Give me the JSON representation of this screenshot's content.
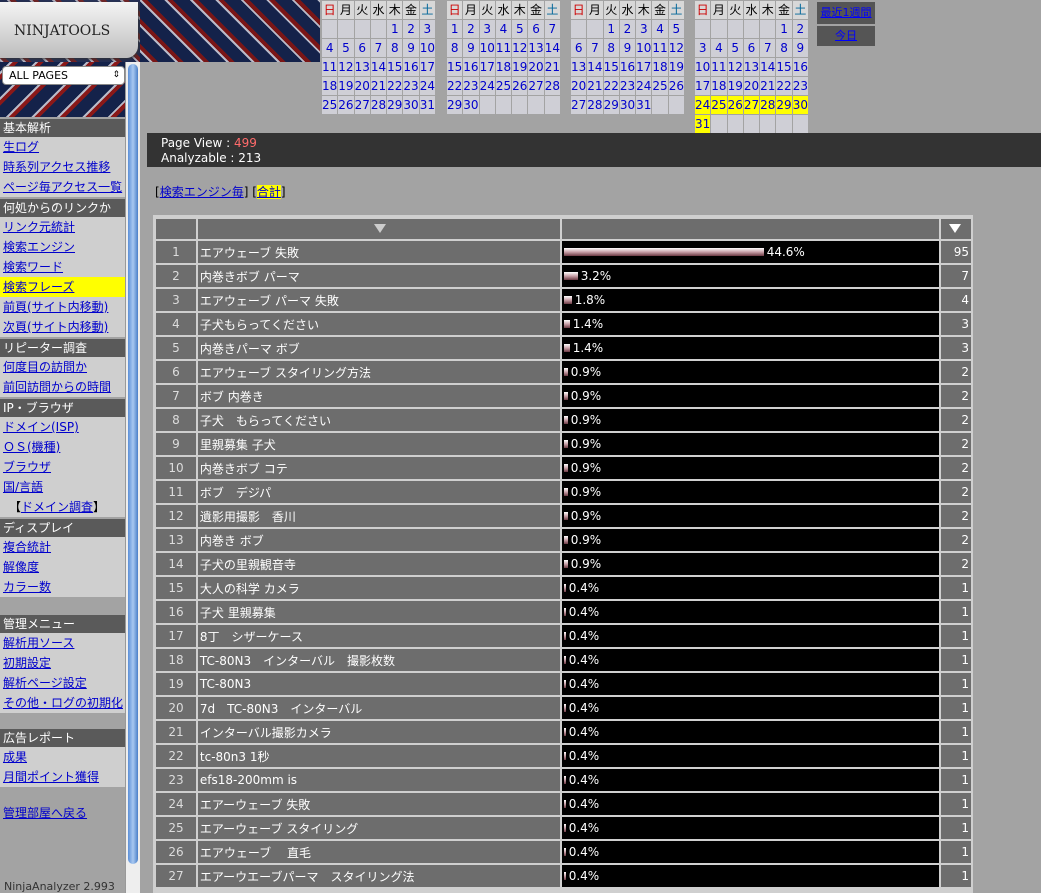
{
  "logo": {
    "text": "NINJATOOLS"
  },
  "page_select": {
    "value": "ALL PAGES"
  },
  "sidebar": [
    {
      "title": "基本解析",
      "items": [
        {
          "label": "生ログ"
        },
        {
          "label": "時系列アクセス推移"
        },
        {
          "label": "ページ毎アクセス一覧"
        }
      ]
    },
    {
      "title": "何処からのリンクか",
      "items": [
        {
          "label": "リンク元統計"
        },
        {
          "label": "検索エンジン"
        },
        {
          "label": "検索ワード"
        },
        {
          "label": "検索フレーズ",
          "active": true
        },
        {
          "label": "前頁(サイト内移動)"
        },
        {
          "label": "次頁(サイト内移動)"
        }
      ]
    },
    {
      "title": "リピーター調査",
      "items": [
        {
          "label": "何度目の訪問か"
        },
        {
          "label": "前回訪問からの時間"
        }
      ]
    },
    {
      "title": "IP・ブラウザ",
      "items": [
        {
          "label": "ドメイン(ISP)"
        },
        {
          "label": "ＯＳ(機種)"
        },
        {
          "label": "ブラウザ"
        },
        {
          "label": "国/言語"
        }
      ],
      "extra": "ドメイン調査"
    },
    {
      "title": "ディスプレイ",
      "items": [
        {
          "label": "複合統計"
        },
        {
          "label": "解像度"
        },
        {
          "label": "カラー数"
        }
      ]
    },
    {
      "title": "管理メニュー",
      "items": [
        {
          "label": "解析用ソース"
        },
        {
          "label": "初期設定"
        },
        {
          "label": "解析ページ設定"
        },
        {
          "label": "その他・ログの初期化"
        }
      ]
    },
    {
      "title": "広告レポート",
      "items": [
        {
          "label": "成果"
        },
        {
          "label": "月間ポイント獲得"
        }
      ]
    }
  ],
  "sidebar_back": "管理部屋へ戻る",
  "footer_version": "NinjaAnalyzer 2.993",
  "calendar": {
    "weekdays": [
      "日",
      "月",
      "火",
      "水",
      "木",
      "金",
      "土"
    ],
    "months": [
      {
        "weeks": [
          [
            "",
            "",
            "",
            "",
            "1",
            "2",
            "3"
          ],
          [
            "4",
            "5",
            "6",
            "7",
            "8",
            "9",
            "10"
          ],
          [
            "11",
            "12",
            "13",
            "14",
            "15",
            "16",
            "17"
          ],
          [
            "18",
            "19",
            "20",
            "21",
            "22",
            "23",
            "24"
          ],
          [
            "25",
            "26",
            "27",
            "28",
            "29",
            "30",
            "31"
          ]
        ]
      },
      {
        "weeks": [
          [
            "1",
            "2",
            "3",
            "4",
            "5",
            "6",
            "7"
          ],
          [
            "8",
            "9",
            "10",
            "11",
            "12",
            "13",
            "14"
          ],
          [
            "15",
            "16",
            "17",
            "18",
            "19",
            "20",
            "21"
          ],
          [
            "22",
            "23",
            "24",
            "25",
            "26",
            "27",
            "28"
          ],
          [
            "29",
            "30",
            "",
            "",
            "",
            "",
            ""
          ]
        ]
      },
      {
        "weeks": [
          [
            "",
            "",
            "1",
            "2",
            "3",
            "4",
            "5"
          ],
          [
            "6",
            "7",
            "8",
            "9",
            "10",
            "11",
            "12"
          ],
          [
            "13",
            "14",
            "15",
            "16",
            "17",
            "18",
            "19"
          ],
          [
            "20",
            "21",
            "22",
            "23",
            "24",
            "25",
            "26"
          ],
          [
            "27",
            "28",
            "29",
            "30",
            "31",
            "",
            ""
          ]
        ]
      },
      {
        "weeks": [
          [
            "",
            "",
            "",
            "",
            "",
            "1",
            "2"
          ],
          [
            "3",
            "4",
            "5",
            "6",
            "7",
            "8",
            "9"
          ],
          [
            "10",
            "11",
            "12",
            "13",
            "14",
            "15",
            "16"
          ],
          [
            "17",
            "18",
            "19",
            "20",
            "21",
            "22",
            "23"
          ],
          [
            "24",
            "25",
            "26",
            "27",
            "28",
            "29",
            "30"
          ],
          [
            "31",
            "",
            "",
            "",
            "",
            "",
            ""
          ]
        ],
        "highlight": [
          "24",
          "25",
          "26",
          "27",
          "28",
          "29",
          "30",
          "31"
        ]
      }
    ],
    "week_button": "最近1週間",
    "today_button": "今日"
  },
  "stats": {
    "page_view_label": "Page View : ",
    "page_view": "499",
    "analyzable_label": "Analyzable : ",
    "analyzable": "213"
  },
  "links": {
    "search_engine": "検索エンジン毎",
    "total": "合計"
  },
  "table": {
    "rows": [
      {
        "rank": "1",
        "phrase": "エアウェーブ 失敗",
        "pct": "44.6%",
        "pct_value": 44.6,
        "count": "95"
      },
      {
        "rank": "2",
        "phrase": "内巻きボブ パーマ",
        "pct": "3.2%",
        "pct_value": 3.2,
        "count": "7"
      },
      {
        "rank": "3",
        "phrase": "エアウェーブ パーマ 失敗",
        "pct": "1.8%",
        "pct_value": 1.8,
        "count": "4"
      },
      {
        "rank": "4",
        "phrase": "子犬もらってください",
        "pct": "1.4%",
        "pct_value": 1.4,
        "count": "3"
      },
      {
        "rank": "5",
        "phrase": "内巻きパーマ ボブ",
        "pct": "1.4%",
        "pct_value": 1.4,
        "count": "3"
      },
      {
        "rank": "6",
        "phrase": "エアウェーブ スタイリング方法",
        "pct": "0.9%",
        "pct_value": 0.9,
        "count": "2"
      },
      {
        "rank": "7",
        "phrase": "ボブ 内巻き",
        "pct": "0.9%",
        "pct_value": 0.9,
        "count": "2"
      },
      {
        "rank": "8",
        "phrase": "子犬　もらってください",
        "pct": "0.9%",
        "pct_value": 0.9,
        "count": "2"
      },
      {
        "rank": "9",
        "phrase": "里親募集 子犬",
        "pct": "0.9%",
        "pct_value": 0.9,
        "count": "2"
      },
      {
        "rank": "10",
        "phrase": "内巻きボブ コテ",
        "pct": "0.9%",
        "pct_value": 0.9,
        "count": "2"
      },
      {
        "rank": "11",
        "phrase": "ボブ　デジパ",
        "pct": "0.9%",
        "pct_value": 0.9,
        "count": "2"
      },
      {
        "rank": "12",
        "phrase": "遺影用撮影　香川",
        "pct": "0.9%",
        "pct_value": 0.9,
        "count": "2"
      },
      {
        "rank": "13",
        "phrase": "内巻き ボブ",
        "pct": "0.9%",
        "pct_value": 0.9,
        "count": "2"
      },
      {
        "rank": "14",
        "phrase": "子犬の里親観音寺",
        "pct": "0.9%",
        "pct_value": 0.9,
        "count": "2"
      },
      {
        "rank": "15",
        "phrase": "大人の科学 カメラ",
        "pct": "0.4%",
        "pct_value": 0.4,
        "count": "1"
      },
      {
        "rank": "16",
        "phrase": "子犬 里親募集",
        "pct": "0.4%",
        "pct_value": 0.4,
        "count": "1"
      },
      {
        "rank": "17",
        "phrase": "8丁　シザーケース",
        "pct": "0.4%",
        "pct_value": 0.4,
        "count": "1"
      },
      {
        "rank": "18",
        "phrase": "TC-80N3　インターバル　撮影枚数",
        "pct": "0.4%",
        "pct_value": 0.4,
        "count": "1"
      },
      {
        "rank": "19",
        "phrase": "TC-80N3",
        "pct": "0.4%",
        "pct_value": 0.4,
        "count": "1"
      },
      {
        "rank": "20",
        "phrase": "7d　TC-80N3　インターバル",
        "pct": "0.4%",
        "pct_value": 0.4,
        "count": "1"
      },
      {
        "rank": "21",
        "phrase": "インターバル撮影カメラ",
        "pct": "0.4%",
        "pct_value": 0.4,
        "count": "1"
      },
      {
        "rank": "22",
        "phrase": "tc-80n3 1秒",
        "pct": "0.4%",
        "pct_value": 0.4,
        "count": "1"
      },
      {
        "rank": "23",
        "phrase": "efs18-200mm is",
        "pct": "0.4%",
        "pct_value": 0.4,
        "count": "1"
      },
      {
        "rank": "24",
        "phrase": "エアーウェーブ 失敗",
        "pct": "0.4%",
        "pct_value": 0.4,
        "count": "1"
      },
      {
        "rank": "25",
        "phrase": "エアーウェーブ スタイリング",
        "pct": "0.4%",
        "pct_value": 0.4,
        "count": "1"
      },
      {
        "rank": "26",
        "phrase": "エアウェーブ　 直毛",
        "pct": "0.4%",
        "pct_value": 0.4,
        "count": "1"
      },
      {
        "rank": "27",
        "phrase": "エアーウエーブパーマ　スタイリング法",
        "pct": "0.4%",
        "pct_value": 0.4,
        "count": "1"
      }
    ]
  }
}
